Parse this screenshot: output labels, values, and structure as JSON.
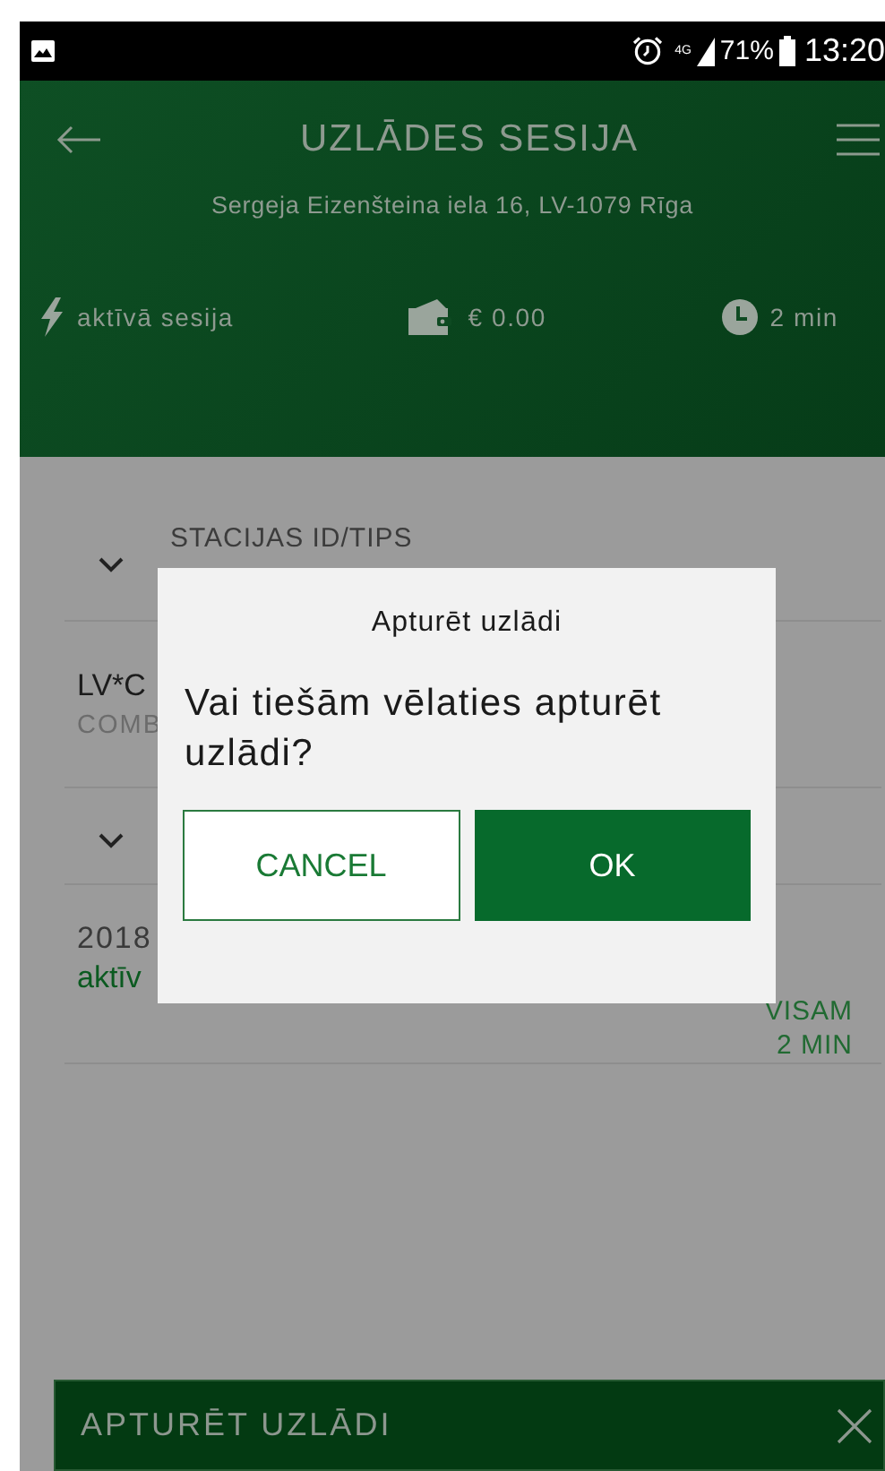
{
  "status_bar": {
    "network": "4G",
    "battery": "71%",
    "time": "13:20"
  },
  "header": {
    "title": "UZLĀDES SESIJA",
    "address": "Sergeja Eizenšteina iela 16, LV-1079 Rīga"
  },
  "stats": [
    {
      "kind": "status",
      "text": "aktīvā sesija"
    },
    {
      "kind": "cost",
      "text": "€ 0.00"
    },
    {
      "kind": "duration",
      "text": "2 min"
    }
  ],
  "background": {
    "station_heading": "STACIJAS ID/TIPS",
    "station_id": "LV*C",
    "connector": "COMB",
    "date": "2018",
    "status": "aktīv",
    "total_label": "VISAM",
    "total_value": "2 MIN"
  },
  "dialog": {
    "title": "Apturēt uzlādi",
    "message": "Vai tiešām vēlaties apturēt uzlādi?",
    "buttons": [
      {
        "kind": "secondary",
        "label": "CANCEL"
      },
      {
        "kind": "primary",
        "label": "OK"
      }
    ]
  },
  "bottom_bar": {
    "label": "APTURĒT UZLĀDI"
  }
}
